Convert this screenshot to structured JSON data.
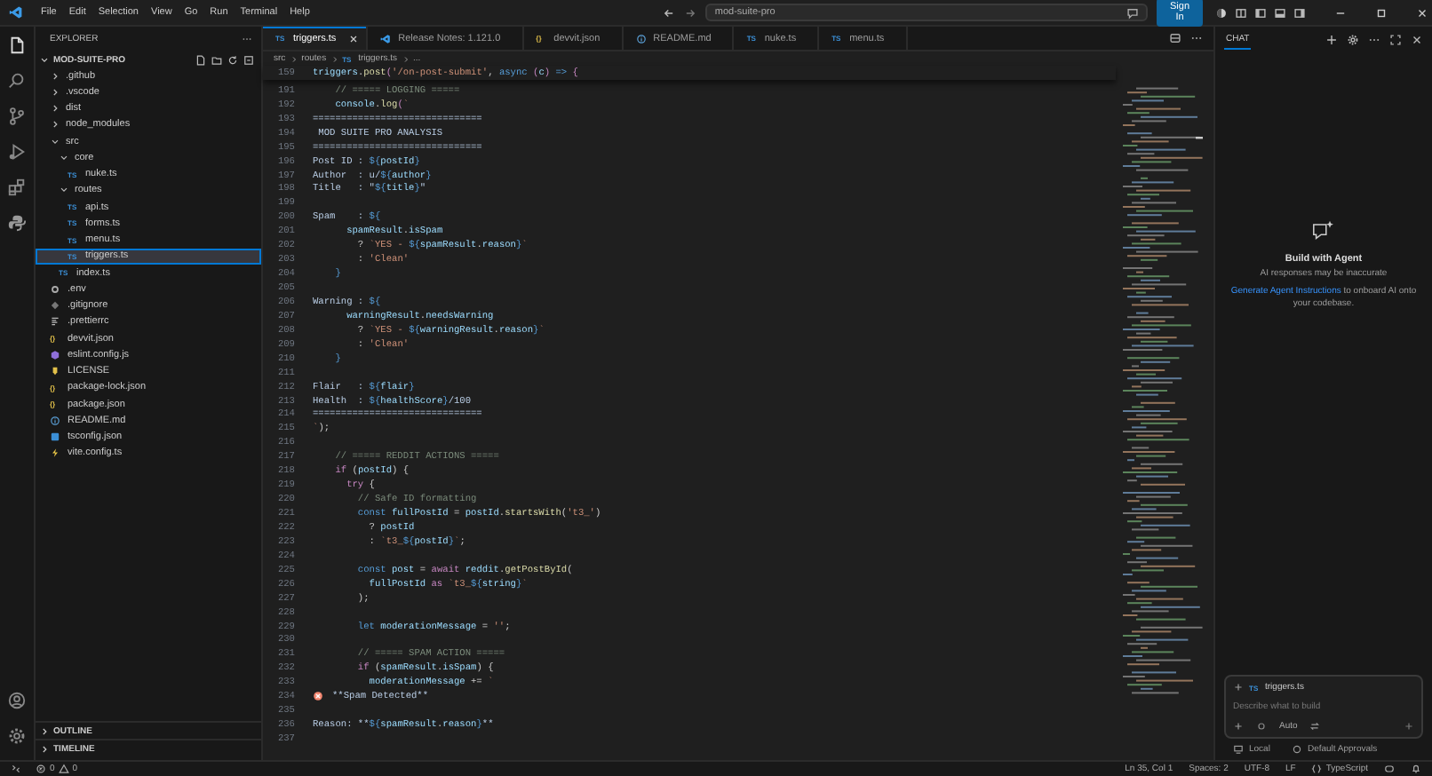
{
  "menu": [
    "File",
    "Edit",
    "Selection",
    "View",
    "Go",
    "Run",
    "Terminal",
    "Help"
  ],
  "command_center": {
    "value": "mod-suite-pro"
  },
  "sign_in": "Sign In",
  "explorer": {
    "title": "EXPLORER",
    "root": "MOD-SUITE-PRO",
    "tree": [
      {
        "label": ".github",
        "kind": "folder",
        "expanded": false,
        "selected": false
      },
      {
        "label": ".vscode",
        "kind": "folder",
        "expanded": false,
        "selected": false
      },
      {
        "label": "dist",
        "kind": "folder",
        "expanded": false,
        "selected": false
      },
      {
        "label": "node_modules",
        "kind": "folder",
        "expanded": false,
        "selected": false
      },
      {
        "label": "src",
        "kind": "folder",
        "expanded": true,
        "selected": false,
        "children": [
          {
            "label": "core",
            "kind": "folder",
            "expanded": true,
            "selected": false,
            "children": [
              {
                "label": "nuke.ts",
                "kind": "ts",
                "icon_text": "TS",
                "selected": false
              }
            ]
          },
          {
            "label": "routes",
            "kind": "folder",
            "expanded": true,
            "selected": false,
            "children": [
              {
                "label": "api.ts",
                "kind": "ts",
                "icon_text": "TS",
                "selected": false
              },
              {
                "label": "forms.ts",
                "kind": "ts",
                "icon_text": "TS",
                "selected": false
              },
              {
                "label": "menu.ts",
                "kind": "ts",
                "icon_text": "TS",
                "selected": false
              },
              {
                "label": "triggers.ts",
                "kind": "ts",
                "icon_text": "TS",
                "selected": true
              }
            ]
          },
          {
            "label": "index.ts",
            "kind": "ts",
            "icon_text": "TS",
            "selected": false
          }
        ]
      },
      {
        "label": ".env",
        "kind": "env",
        "selected": false
      },
      {
        "label": ".gitignore",
        "kind": "git",
        "selected": false
      },
      {
        "label": ".prettierrc",
        "kind": "prettier",
        "selected": false
      },
      {
        "label": "devvit.json",
        "kind": "json",
        "icon_text": "{}",
        "selected": false
      },
      {
        "label": "eslint.config.js",
        "kind": "eslint",
        "selected": false
      },
      {
        "label": "LICENSE",
        "kind": "license",
        "selected": false
      },
      {
        "label": "package-lock.json",
        "kind": "json",
        "icon_text": "{}",
        "selected": false
      },
      {
        "label": "package.json",
        "kind": "json",
        "icon_text": "{}",
        "selected": false
      },
      {
        "label": "README.md",
        "kind": "info",
        "selected": false
      },
      {
        "label": "tsconfig.json",
        "kind": "tsconfig",
        "selected": false
      },
      {
        "label": "vite.config.ts",
        "kind": "vite",
        "selected": false
      }
    ],
    "sections": [
      {
        "label": "OUTLINE",
        "expanded": false
      },
      {
        "label": "TIMELINE",
        "expanded": false
      }
    ]
  },
  "tabs": [
    {
      "label": "triggers.ts",
      "kind": "ts",
      "icon_text": "TS",
      "selected": true
    },
    {
      "label": "Release Notes: 1.121.0",
      "kind": "vscode",
      "selected": false
    },
    {
      "label": "devvit.json",
      "kind": "json",
      "icon_text": "{}",
      "selected": false
    },
    {
      "label": "README.md",
      "kind": "info",
      "selected": false
    },
    {
      "label": "nuke.ts",
      "kind": "ts",
      "icon_text": "TS",
      "selected": false
    },
    {
      "label": "menu.ts",
      "kind": "ts",
      "icon_text": "TS",
      "selected": false
    }
  ],
  "breadcrumb": [
    {
      "label": "src"
    },
    {
      "label": "routes"
    },
    {
      "label": "triggers.ts",
      "icon_text": "TS"
    },
    {
      "label": "..."
    }
  ],
  "code": {
    "sticky": {
      "num": "159",
      "tokens": [
        {
          "text": "triggers",
          "kind": "v"
        },
        {
          "text": ".",
          "kind": "p"
        },
        {
          "text": "post",
          "kind": "f"
        },
        {
          "text": "(",
          "kind": "c"
        },
        {
          "text": "'/on-post-submit'",
          "kind": "s"
        },
        {
          "text": ", ",
          "kind": "p"
        },
        {
          "text": "async",
          "kind": "k"
        },
        {
          "text": " (",
          "kind": "c"
        },
        {
          "text": "c",
          "kind": "v"
        },
        {
          "text": ")",
          "kind": "c"
        },
        {
          "text": " => ",
          "kind": "k"
        },
        {
          "text": "{",
          "kind": "c"
        }
      ]
    },
    "lines": [
      {
        "num": "191",
        "tokens": [
          {
            "text": "    // ===== LOGGING =====",
            "kind": "m"
          }
        ]
      },
      {
        "num": "192",
        "tokens": [
          {
            "text": "    console",
            "kind": "v"
          },
          {
            "text": ".",
            "kind": "p"
          },
          {
            "text": "log",
            "kind": "f"
          },
          {
            "text": "(",
            "kind": "c"
          },
          {
            "text": "`",
            "kind": "s"
          }
        ]
      },
      {
        "num": "193",
        "tokens": [
          {
            "text": "==============================",
            "kind": "t"
          }
        ]
      },
      {
        "num": "194",
        "tokens": [
          {
            "text": " MOD SUITE PRO ANALYSIS",
            "kind": "t"
          }
        ]
      },
      {
        "num": "195",
        "tokens": [
          {
            "text": "==============================",
            "kind": "t"
          }
        ]
      },
      {
        "num": "196",
        "tokens": [
          {
            "text": "Post ID : ",
            "kind": "t"
          },
          {
            "text": "${",
            "kind": "i"
          },
          {
            "text": "postId",
            "kind": "v"
          },
          {
            "text": "}",
            "kind": "i"
          }
        ]
      },
      {
        "num": "197",
        "tokens": [
          {
            "text": "Author  : u/",
            "kind": "t"
          },
          {
            "text": "${",
            "kind": "i"
          },
          {
            "text": "author",
            "kind": "v"
          },
          {
            "text": "}",
            "kind": "i"
          }
        ]
      },
      {
        "num": "198",
        "tokens": [
          {
            "text": "Title   : \"",
            "kind": "t"
          },
          {
            "text": "${",
            "kind": "i"
          },
          {
            "text": "title",
            "kind": "v"
          },
          {
            "text": "}",
            "kind": "i"
          },
          {
            "text": "\"",
            "kind": "t"
          }
        ]
      },
      {
        "num": "199"
      },
      {
        "num": "200",
        "tokens": [
          {
            "text": "Spam    : ",
            "kind": "t"
          },
          {
            "text": "${",
            "kind": "i"
          }
        ]
      },
      {
        "num": "201",
        "tokens": [
          {
            "text": "      spamResult",
            "kind": "v"
          },
          {
            "text": ".",
            "kind": "p"
          },
          {
            "text": "isSpam",
            "kind": "v"
          }
        ]
      },
      {
        "num": "202",
        "tokens": [
          {
            "text": "        ? ",
            "kind": "p"
          },
          {
            "text": "`YES - ",
            "kind": "s"
          },
          {
            "text": "${",
            "kind": "i"
          },
          {
            "text": "spamResult",
            "kind": "v"
          },
          {
            "text": ".",
            "kind": "p"
          },
          {
            "text": "reason",
            "kind": "v"
          },
          {
            "text": "}",
            "kind": "i"
          },
          {
            "text": "`",
            "kind": "s"
          }
        ]
      },
      {
        "num": "203",
        "tokens": [
          {
            "text": "        : ",
            "kind": "p"
          },
          {
            "text": "'Clean'",
            "kind": "s"
          }
        ]
      },
      {
        "num": "204",
        "tokens": [
          {
            "text": "    }",
            "kind": "i"
          }
        ]
      },
      {
        "num": "205"
      },
      {
        "num": "206",
        "tokens": [
          {
            "text": "Warning : ",
            "kind": "t"
          },
          {
            "text": "${",
            "kind": "i"
          }
        ]
      },
      {
        "num": "207",
        "tokens": [
          {
            "text": "      warningResult",
            "kind": "v"
          },
          {
            "text": ".",
            "kind": "p"
          },
          {
            "text": "needsWarning",
            "kind": "v"
          }
        ]
      },
      {
        "num": "208",
        "tokens": [
          {
            "text": "        ? ",
            "kind": "p"
          },
          {
            "text": "`YES - ",
            "kind": "s"
          },
          {
            "text": "${",
            "kind": "i"
          },
          {
            "text": "warningResult",
            "kind": "v"
          },
          {
            "text": ".",
            "kind": "p"
          },
          {
            "text": "reason",
            "kind": "v"
          },
          {
            "text": "}",
            "kind": "i"
          },
          {
            "text": "`",
            "kind": "s"
          }
        ]
      },
      {
        "num": "209",
        "tokens": [
          {
            "text": "        : ",
            "kind": "p"
          },
          {
            "text": "'Clean'",
            "kind": "s"
          }
        ]
      },
      {
        "num": "210",
        "tokens": [
          {
            "text": "    }",
            "kind": "i"
          }
        ]
      },
      {
        "num": "211"
      },
      {
        "num": "212",
        "tokens": [
          {
            "text": "Flair   : ",
            "kind": "t"
          },
          {
            "text": "${",
            "kind": "i"
          },
          {
            "text": "flair",
            "kind": "v"
          },
          {
            "text": "}",
            "kind": "i"
          }
        ]
      },
      {
        "num": "213",
        "tokens": [
          {
            "text": "Health  : ",
            "kind": "t"
          },
          {
            "text": "${",
            "kind": "i"
          },
          {
            "text": "healthScore",
            "kind": "v"
          },
          {
            "text": "}",
            "kind": "i"
          },
          {
            "text": "/100",
            "kind": "t"
          }
        ]
      },
      {
        "num": "214",
        "tokens": [
          {
            "text": "==============================",
            "kind": "t"
          }
        ]
      },
      {
        "num": "215",
        "tokens": [
          {
            "text": "`",
            "kind": "s"
          },
          {
            "text": ");",
            "kind": "p"
          }
        ]
      },
      {
        "num": "216"
      },
      {
        "num": "217",
        "tokens": [
          {
            "text": "    // ===== REDDIT ACTIONS =====",
            "kind": "m"
          }
        ]
      },
      {
        "num": "218",
        "tokens": [
          {
            "text": "    if",
            "kind": "c"
          },
          {
            "text": " (",
            "kind": "p"
          },
          {
            "text": "postId",
            "kind": "v"
          },
          {
            "text": ") {",
            "kind": "p"
          }
        ]
      },
      {
        "num": "219",
        "tokens": [
          {
            "text": "      try",
            "kind": "c"
          },
          {
            "text": " {",
            "kind": "p"
          }
        ]
      },
      {
        "num": "220",
        "tokens": [
          {
            "text": "        // Safe ID formatting",
            "kind": "m"
          }
        ]
      },
      {
        "num": "221",
        "tokens": [
          {
            "text": "        const",
            "kind": "k"
          },
          {
            "text": " fullPostId",
            "kind": "v"
          },
          {
            "text": " = ",
            "kind": "p"
          },
          {
            "text": "postId",
            "kind": "v"
          },
          {
            "text": ".",
            "kind": "p"
          },
          {
            "text": "startsWith",
            "kind": "f"
          },
          {
            "text": "(",
            "kind": "p"
          },
          {
            "text": "'t3_'",
            "kind": "s"
          },
          {
            "text": ")",
            "kind": "p"
          }
        ]
      },
      {
        "num": "222",
        "tokens": [
          {
            "text": "          ? ",
            "kind": "p"
          },
          {
            "text": "postId",
            "kind": "v"
          }
        ]
      },
      {
        "num": "223",
        "tokens": [
          {
            "text": "          : ",
            "kind": "p"
          },
          {
            "text": "`t3_",
            "kind": "s"
          },
          {
            "text": "${",
            "kind": "i"
          },
          {
            "text": "postId",
            "kind": "v"
          },
          {
            "text": "}",
            "kind": "i"
          },
          {
            "text": "`",
            "kind": "s"
          },
          {
            "text": ";",
            "kind": "p"
          }
        ]
      },
      {
        "num": "224"
      },
      {
        "num": "225",
        "tokens": [
          {
            "text": "        const",
            "kind": "k"
          },
          {
            "text": " post",
            "kind": "v"
          },
          {
            "text": " = ",
            "kind": "p"
          },
          {
            "text": "await",
            "kind": "c"
          },
          {
            "text": " reddit",
            "kind": "v"
          },
          {
            "text": ".",
            "kind": "p"
          },
          {
            "text": "getPostById",
            "kind": "f"
          },
          {
            "text": "(",
            "kind": "p"
          }
        ]
      },
      {
        "num": "226",
        "tokens": [
          {
            "text": "          fullPostId",
            "kind": "v"
          },
          {
            "text": " as ",
            "kind": "c"
          },
          {
            "text": "`t3_",
            "kind": "s"
          },
          {
            "text": "${",
            "kind": "i"
          },
          {
            "text": "string",
            "kind": "v"
          },
          {
            "text": "}",
            "kind": "i"
          },
          {
            "text": "`",
            "kind": "s"
          }
        ]
      },
      {
        "num": "227",
        "tokens": [
          {
            "text": "        );",
            "kind": "p"
          }
        ]
      },
      {
        "num": "228"
      },
      {
        "num": "229",
        "tokens": [
          {
            "text": "        let",
            "kind": "k"
          },
          {
            "text": " moderationMessage",
            "kind": "v"
          },
          {
            "text": " = ",
            "kind": "p"
          },
          {
            "text": "''",
            "kind": "s"
          },
          {
            "text": ";",
            "kind": "p"
          }
        ]
      },
      {
        "num": "230"
      },
      {
        "num": "231",
        "tokens": [
          {
            "text": "        // ===== SPAM ACTION =====",
            "kind": "m"
          }
        ]
      },
      {
        "num": "232",
        "tokens": [
          {
            "text": "        if",
            "kind": "c"
          },
          {
            "text": " (",
            "kind": "p"
          },
          {
            "text": "spamResult",
            "kind": "v"
          },
          {
            "text": ".",
            "kind": "p"
          },
          {
            "text": "isSpam",
            "kind": "v"
          },
          {
            "text": ") {",
            "kind": "p"
          }
        ]
      },
      {
        "num": "233",
        "tokens": [
          {
            "text": "          moderationMessage",
            "kind": "v"
          },
          {
            "text": " += ",
            "kind": "p"
          },
          {
            "text": "`",
            "kind": "s"
          }
        ]
      },
      {
        "num": "234",
        "error": true,
        "tokens": [
          {
            "text": "**Spam Detected**",
            "kind": "t"
          }
        ]
      },
      {
        "num": "235"
      },
      {
        "num": "236",
        "tokens": [
          {
            "text": "Reason: **",
            "kind": "t"
          },
          {
            "text": "${",
            "kind": "i"
          },
          {
            "text": "spamResult",
            "kind": "v"
          },
          {
            "text": ".",
            "kind": "p"
          },
          {
            "text": "reason",
            "kind": "v"
          },
          {
            "text": "}",
            "kind": "i"
          },
          {
            "text": "**",
            "kind": "t"
          }
        ]
      },
      {
        "num": "237"
      }
    ]
  },
  "chat": {
    "tab": "CHAT",
    "title": "Build with Agent",
    "note": "AI responses may be inaccurate",
    "link": "Generate Agent Instructions",
    "after_link": " to onboard AI onto your codebase.",
    "context": {
      "icon_text": "TS",
      "label": "triggers.ts"
    },
    "placeholder": "Describe what to build",
    "mode": "Auto",
    "location": "Local",
    "approvals": "Default Approvals"
  },
  "status": {
    "errors": "0",
    "warnings": "0",
    "position": "Ln 35, Col 1",
    "spaces": "Spaces: 2",
    "encoding": "UTF-8",
    "eol": "LF",
    "language": "TypeScript"
  }
}
